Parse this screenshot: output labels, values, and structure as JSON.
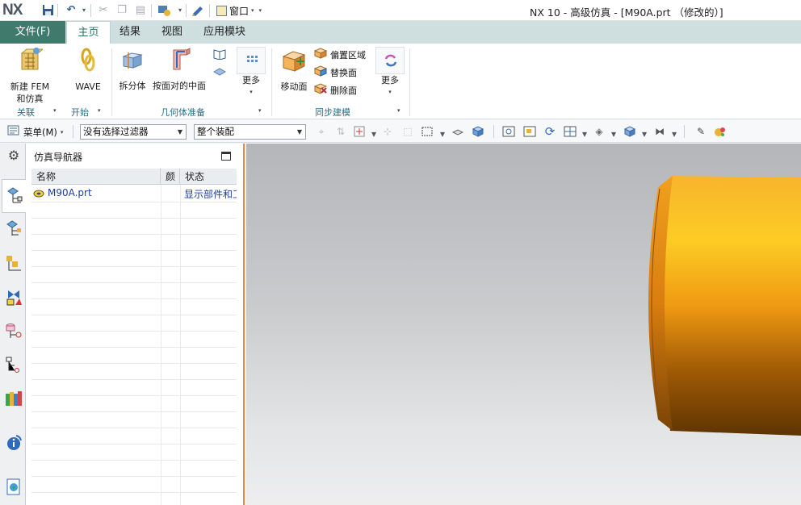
{
  "app": {
    "logo": "NX",
    "title": "NX 10 - 高级仿真 - [M90A.prt （修改的）]",
    "window_menu": "窗口"
  },
  "tabs": {
    "file": "文件(F)",
    "items": [
      "主页",
      "结果",
      "视图",
      "应用模块"
    ],
    "active": "主页"
  },
  "ribbon": {
    "new_fem_line1": "新建 FEM",
    "new_fem_line2": "和仿真",
    "wave": "WAVE",
    "split_body": "拆分体",
    "midsurface": "按面对的中面",
    "more1": "更多",
    "move_face": "移动面",
    "offset_region": "偏置区域",
    "replace_face": "替换面",
    "delete_face": "删除面",
    "more2": "更多",
    "groups": {
      "association": "关联",
      "start": "开始",
      "geometry_prep": "几何体准备",
      "sync_modeling": "同步建模"
    }
  },
  "toolbar": {
    "menu": "菜单(M)",
    "filter": "没有选择过滤器",
    "scope": "整个装配"
  },
  "navigator": {
    "title": "仿真导航器",
    "columns": [
      "名称",
      "颜",
      "状态"
    ],
    "rows": [
      {
        "name": "M90A.prt",
        "status": "显示部件和工"
      }
    ]
  },
  "colors": {
    "file_tab": "#3f7a6c",
    "tab_bar": "#cfdfe0",
    "accent_border": "#e08a48",
    "part_orange": "#f4a81c"
  },
  "icons": [
    "save-icon",
    "undo-icon",
    "cut-icon",
    "copy-icon",
    "paste-icon",
    "settings-icon",
    "gear-icon",
    "navigator-icon",
    "fem-icon",
    "wave-icon",
    "split-body-icon",
    "midsurface-icon",
    "move-face-icon",
    "more-icon"
  ]
}
